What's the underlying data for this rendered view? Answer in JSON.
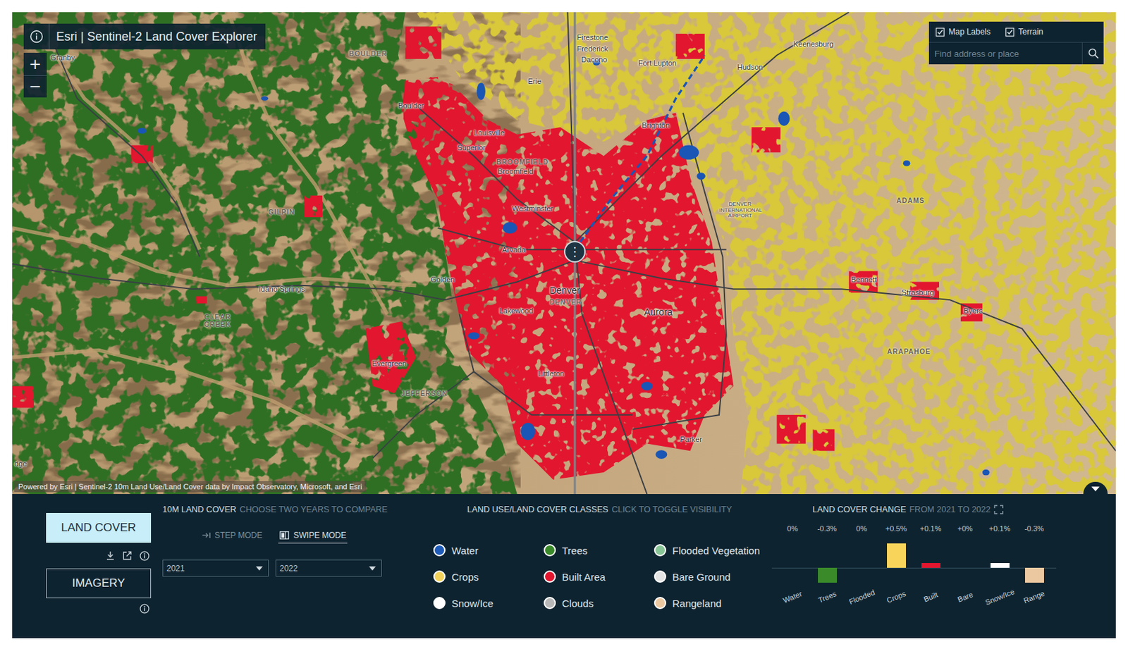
{
  "app": {
    "title": "Esri | Sentinel-2 Land Cover Explorer"
  },
  "zoom": [
    {
      "label": "+"
    },
    {
      "label": "−"
    }
  ],
  "map_options": [
    {
      "label": "Map Labels",
      "checked": true
    },
    {
      "label": "Terrain",
      "checked": true
    }
  ],
  "search": {
    "placeholder": "Find address or place"
  },
  "map_labels": [
    {
      "text": "BOULDER",
      "kind": "county"
    },
    {
      "text": "Granby",
      "kind": "town"
    },
    {
      "text": "Firestone",
      "kind": "town"
    },
    {
      "text": "Frederick",
      "kind": "town"
    },
    {
      "text": "Dacono",
      "kind": "town"
    },
    {
      "text": "Fort Lupton",
      "kind": "town"
    },
    {
      "text": "Keenesburg",
      "kind": "town"
    },
    {
      "text": "Hudson",
      "kind": "town"
    },
    {
      "text": "Erie",
      "kind": "town"
    },
    {
      "text": "Boulder",
      "kind": "town"
    },
    {
      "text": "Louisville",
      "kind": "town"
    },
    {
      "text": "Superior",
      "kind": "town"
    },
    {
      "text": "Brighton",
      "kind": "town"
    },
    {
      "text": "BROOMFIELD",
      "kind": "county"
    },
    {
      "text": "Broomfield",
      "kind": "town"
    },
    {
      "text": "Westminster",
      "kind": "town"
    },
    {
      "text": "GILPIN",
      "kind": "county"
    },
    {
      "text": "DENVER INTERNATIONAL AIRPORT",
      "kind": "airport"
    },
    {
      "text": "ADAMS",
      "kind": "county"
    },
    {
      "text": "Arvada",
      "kind": "town"
    },
    {
      "text": "Golden",
      "kind": "town"
    },
    {
      "text": "Idaho Springs",
      "kind": "town"
    },
    {
      "text": "CLEAR CREEK",
      "kind": "county"
    },
    {
      "text": "Denver",
      "kind": "city"
    },
    {
      "text": "DENVER",
      "kind": "county"
    },
    {
      "text": "Lakewood",
      "kind": "town"
    },
    {
      "text": "Aurora",
      "kind": "city"
    },
    {
      "text": "Bennett",
      "kind": "town"
    },
    {
      "text": "Strasburg",
      "kind": "town"
    },
    {
      "text": "Byers",
      "kind": "town"
    },
    {
      "text": "ARAPAHOE",
      "kind": "county"
    },
    {
      "text": "Evergreen",
      "kind": "town"
    },
    {
      "text": "JEFFERSON",
      "kind": "county"
    },
    {
      "text": "Littleton",
      "kind": "town"
    },
    {
      "text": "Parker",
      "kind": "town"
    },
    {
      "text": "dge",
      "kind": "town"
    }
  ],
  "swipe": {
    "handle": "⋮"
  },
  "attribution": "Powered by Esri | Sentinel-2 10m Land Use/Land Cover data by Impact Observatory, Microsoft, and Esri",
  "layers": [
    {
      "label": "LAND COVER",
      "selected": true
    },
    {
      "label": "IMAGERY",
      "selected": false
    }
  ],
  "compare": {
    "title": "10M LAND COVER",
    "hint": "CHOOSE TWO YEARS TO COMPARE",
    "modes": [
      {
        "label": "STEP MODE",
        "selected": false
      },
      {
        "label": "SWIPE MODE",
        "selected": true
      }
    ],
    "years": [
      {
        "value": "2021"
      },
      {
        "value": "2022"
      }
    ]
  },
  "classes": {
    "title": "LAND USE/LAND COVER CLASSES",
    "hint": "CLICK TO TOGGLE VISIBILITY",
    "items": [
      {
        "name": "Water",
        "color": "#1f5bb8"
      },
      {
        "name": "Trees",
        "color": "#3a8a2a"
      },
      {
        "name": "Flooded Vegetation",
        "color": "#88c596"
      },
      {
        "name": "Crops",
        "color": "#f2d25a"
      },
      {
        "name": "Built Area",
        "color": "#e2162f"
      },
      {
        "name": "Bare Ground",
        "color": "#e4e4e4"
      },
      {
        "name": "Snow/Ice",
        "color": "#ffffff"
      },
      {
        "name": "Clouds",
        "color": "#b8b8b8"
      },
      {
        "name": "Rangeland",
        "color": "#ecc8a0"
      }
    ]
  },
  "change": {
    "title": "LAND COVER CHANGE",
    "hint": "FROM 2021 TO 2022",
    "bars": [
      {
        "label": "Water",
        "reading": "0%",
        "value": 0,
        "color": "#1f5bb8"
      },
      {
        "label": "Trees",
        "reading": "-0.3%",
        "value": -0.3,
        "color": "#3a8a2a"
      },
      {
        "label": "Flooded",
        "reading": "0%",
        "value": 0,
        "color": "#88c596"
      },
      {
        "label": "Crops",
        "reading": "+0.5%",
        "value": 0.5,
        "color": "#f9d45a"
      },
      {
        "label": "Built",
        "reading": "+0.1%",
        "value": 0.1,
        "color": "#e2162f"
      },
      {
        "label": "Bare",
        "reading": "+0%",
        "value": 0,
        "color": "#e4e4e4"
      },
      {
        "label": "Snow/Ice",
        "reading": "+0.1%",
        "value": 0.1,
        "color": "#ffffff"
      },
      {
        "label": "Range",
        "reading": "-0.3%",
        "value": -0.3,
        "color": "#ecc8a0"
      }
    ]
  }
}
